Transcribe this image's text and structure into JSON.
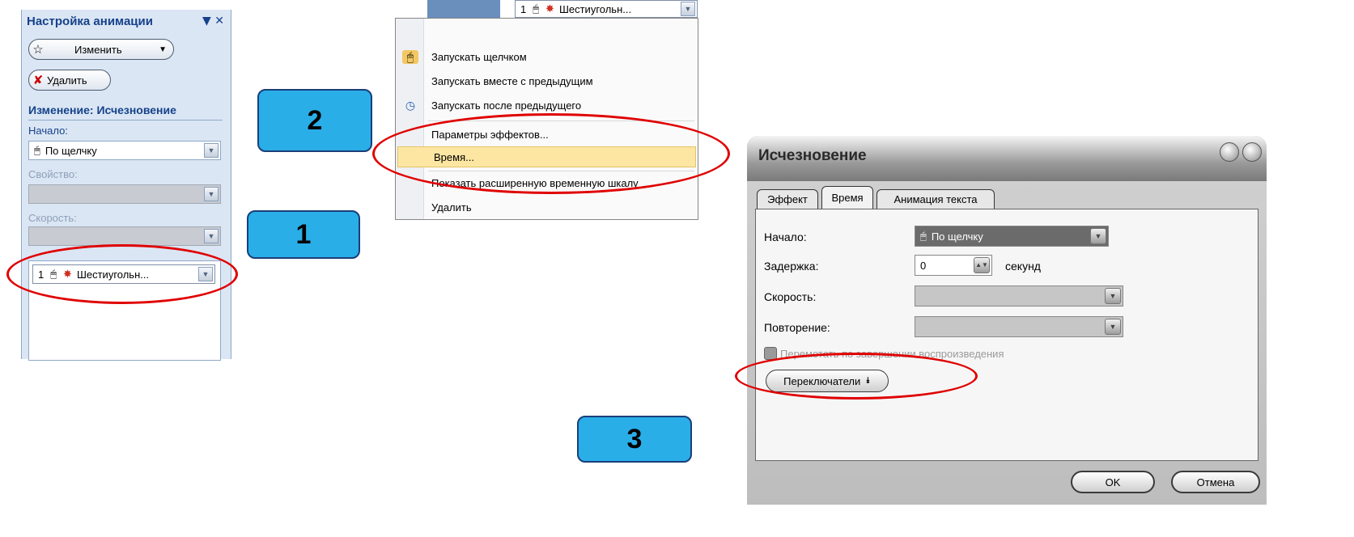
{
  "task_pane": {
    "title": "Настройка анимации",
    "title_controls": "▼ ✕",
    "change_button": "Изменить",
    "delete_button": "Удалить",
    "section_header": "Изменение: Исчезновение",
    "start_label": "Начало:",
    "start_value": "По щелчку",
    "property_label": "Свойство:",
    "speed_label": "Скорость:",
    "list_item": {
      "index": "1",
      "name": "Шестиугольн..."
    }
  },
  "callouts": {
    "one": "1",
    "two": "2",
    "three": "3"
  },
  "context_menu": {
    "header_index": "1",
    "header_name": "Шестиугольн...",
    "items": [
      "Запускать щелчком",
      "Запускать вместе с предыдущим",
      "Запускать после предыдущего",
      "Параметры эффектов...",
      "Время...",
      "Показать расширенную временную шкалу",
      "Удалить"
    ]
  },
  "dialog": {
    "title": "Исчезновение",
    "tabs": [
      "Эффект",
      "Время",
      "Анимация текста"
    ],
    "start_label": "Начало:",
    "start_value": "По щелчку",
    "delay_label": "Задержка:",
    "delay_value": "0",
    "delay_unit": "секунд",
    "speed_label": "Скорость:",
    "repeat_label": "Повторение:",
    "rewind_label": "Перемотать по завершении воспроизведения",
    "triggers_button": "Переключатели",
    "ok_button": "OK",
    "cancel_button": "Отмена"
  },
  "colors": {
    "callout": "#29aee8",
    "highlight_ring": "#e00000",
    "menu_highlight": "#fde6a2"
  }
}
